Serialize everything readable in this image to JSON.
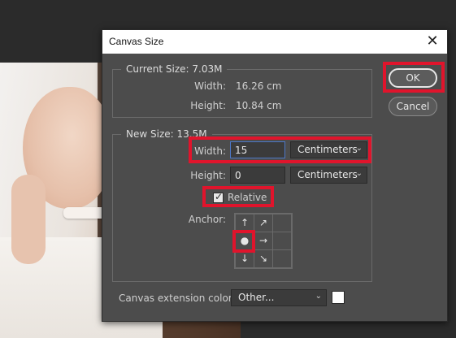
{
  "dialog": {
    "title": "Canvas Size",
    "close_glyph": "✕"
  },
  "current_size": {
    "legend": "Current Size: 7.03M",
    "width_label": "Width:",
    "width_value": "16.26 cm",
    "height_label": "Height:",
    "height_value": "10.84 cm"
  },
  "new_size": {
    "legend": "New Size: 13.5M",
    "width_label": "Width:",
    "width_value": "15",
    "width_unit": "Centimeters",
    "height_label": "Height:",
    "height_value": "0",
    "height_unit": "Centimeters",
    "relative_label": "Relative",
    "relative_checked": true,
    "anchor_label": "Anchor:",
    "anchor_cells": [
      "↑",
      "↗",
      "",
      "●",
      "→",
      "",
      "↓",
      "↘",
      ""
    ]
  },
  "canvas_extension": {
    "label": "Canvas extension color:",
    "value": "Other...",
    "swatch_color": "#ffffff"
  },
  "buttons": {
    "ok": "OK",
    "cancel": "Cancel"
  },
  "highlight_color": "#e0142c"
}
